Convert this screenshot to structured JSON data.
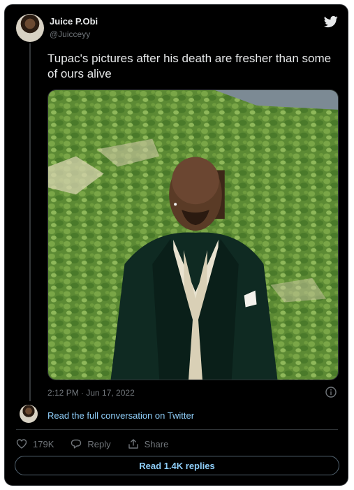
{
  "tweet": {
    "author_name": "Juice P.Obi",
    "author_handle": "@Juicceyy",
    "text": "Tupac's pictures after his death are fresher than some of ours alive",
    "timestamp": "2:12 PM · Jun 17, 2022",
    "logo_icon": "twitter-bird-icon",
    "info_icon": "info-icon"
  },
  "conversation": {
    "link_text": "Read the full conversation on Twitter"
  },
  "actions": {
    "like_count": "179K",
    "reply_label": "Reply",
    "share_label": "Share"
  },
  "replies_button": {
    "label": "Read 1.4K replies"
  },
  "colors": {
    "background": "#000000",
    "text": "#e7e9ea",
    "muted": "#71767b",
    "link": "#8ecdf8",
    "border": "#2f3336",
    "brand": "#1d9bf0"
  }
}
